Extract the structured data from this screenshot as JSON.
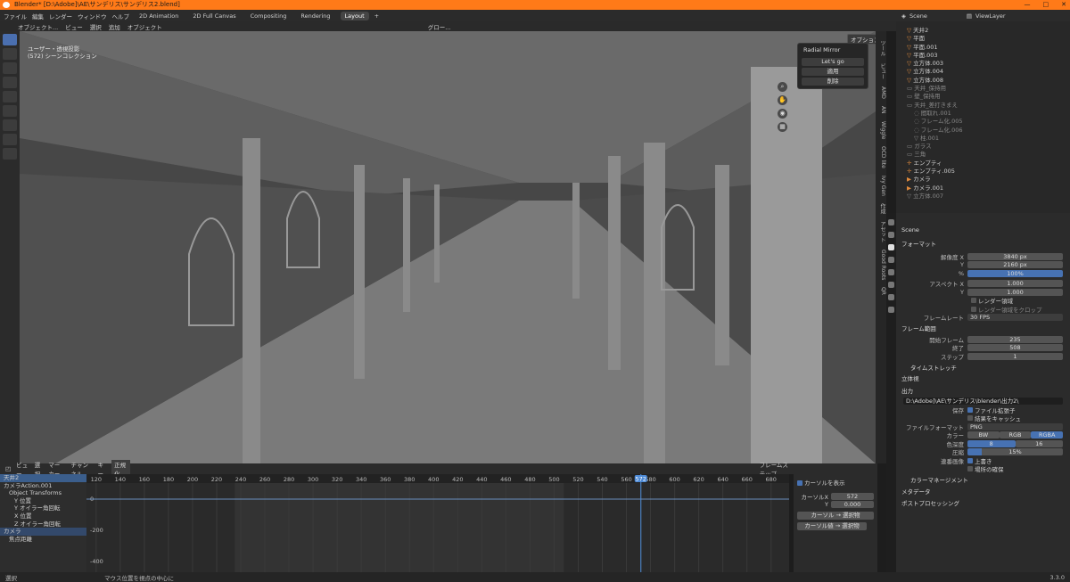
{
  "title": "Blender* [D:\\Adobe]\\AE\\サンデリス\\サンデリス2.blend]",
  "menu": [
    "ファイル",
    "編集",
    "レンダー",
    "ウィンドウ",
    "ヘルプ"
  ],
  "workspaces": [
    "2D Animation",
    "2D Full Canvas",
    "Compositing",
    "Rendering",
    "Layout"
  ],
  "scene": {
    "label": "Scene",
    "viewlayer": "ViewLayer"
  },
  "viewport_header": {
    "mode": "オブジェクト...",
    "items": [
      "ビュー",
      "選択",
      "追加",
      "オブジェクト"
    ],
    "pivot": "グロー..."
  },
  "viewport": {
    "line1": "ユーザー・透視投影",
    "line2": "(572) シーンコレクション",
    "options": "オプション"
  },
  "radial": {
    "title": "Radial Mirror",
    "btn1": "Let's go",
    "btn2": "適用",
    "btn3": "削除"
  },
  "side_tabs": [
    "ツール",
    "ビュー",
    "AMD",
    "AN",
    "Wiggle",
    "OCD lite",
    "Ivy Gen",
    "作成",
    "アセット",
    "Good Roots",
    "QR"
  ],
  "outliner": [
    "天井2",
    "平面",
    "平面.001",
    "平面.003",
    "立方体.003",
    "立方体.004",
    "立方体.008",
    "天井_保持用",
    "壁_保持用",
    "天井_差打きまえ",
    "間取れ.001",
    "フレーム化.005",
    "フレーム化.006",
    "柱.001",
    "ガラス",
    "三角",
    "エンプティ",
    "エンプティ.005",
    "カメラ",
    "カメラ.001",
    "立方体.007"
  ],
  "props": {
    "scene": "Scene",
    "format_title": "フォーマット",
    "res_x_label": "解像度 X",
    "res_x": "3840 px",
    "res_y_label": "Y",
    "res_y": "2160 px",
    "pct_label": "%",
    "pct": "100%",
    "aspect_x_label": "アスペクト X",
    "aspect_x": "1.000",
    "aspect_y_label": "Y",
    "aspect_y": "1.000",
    "render_region": "レンダー領域",
    "crop": "レンダー領域をクロップ",
    "framerate_label": "フレームレート",
    "framerate": "30 FPS",
    "frame_range": "フレーム範囲",
    "start_label": "開始フレーム",
    "start": "235",
    "end_label": "終了",
    "end": "508",
    "step_label": "ステップ",
    "step": "1",
    "timestretch": "タイムストレッチ",
    "stereo": "立体視",
    "output": "出力",
    "path": "D:\\Adobe]\\AE\\サンデリス\\blender\\出力2\\",
    "save_label": "保存",
    "file_ext": "ファイル拡張子",
    "cache": "結果をキャッシュ",
    "fileformat_label": "ファイルフォーマット",
    "fileformat": "PNG",
    "color_label": "カラー",
    "bw": "BW",
    "rgb": "RGB",
    "rgba": "RGBA",
    "depth_label": "色深度",
    "d8": "8",
    "d16": "16",
    "compress_label": "圧縮",
    "compress": "15%",
    "seq_label": "連番画像",
    "overwrite": "上書き",
    "placeholders": "場所の確保",
    "color_mgmt": "カラーマネージメント",
    "metadata": "メタデータ",
    "postproc": "ポストプロセッシング"
  },
  "graph_header": {
    "items": [
      "ビュー",
      "選択",
      "マーカー",
      "チャンネル",
      "キー"
    ],
    "normalize": "正規化",
    "pivot": "フレームステップ"
  },
  "graph_channels": [
    "天井2",
    "カメラAction.001",
    "Object Transforms",
    "Y 位置",
    "Y オイラー角回転",
    "X 位置",
    "Z オイラー角回転",
    "カメラ",
    "焦点距離"
  ],
  "frame_ticks": [
    "120",
    "140",
    "160",
    "180",
    "200",
    "220",
    "240",
    "260",
    "280",
    "300",
    "320",
    "340",
    "360",
    "380",
    "400",
    "420",
    "440",
    "460",
    "480",
    "500",
    "520",
    "540",
    "560",
    "572",
    "580",
    "600",
    "620",
    "640",
    "660",
    "680"
  ],
  "value_ticks": [
    "0",
    "-200",
    "-400"
  ],
  "cursor": {
    "show": "カーソルを表示",
    "x_label": "カーソルX",
    "x": "572",
    "y_label": "Y",
    "y": "0.000",
    "btn1": "カーソル → 選択物",
    "btn2": "カーソル値 → 選択物"
  },
  "status": {
    "left": "選択",
    "mid": "マウス位置を視点の中心に",
    "version": "3.3.0"
  }
}
